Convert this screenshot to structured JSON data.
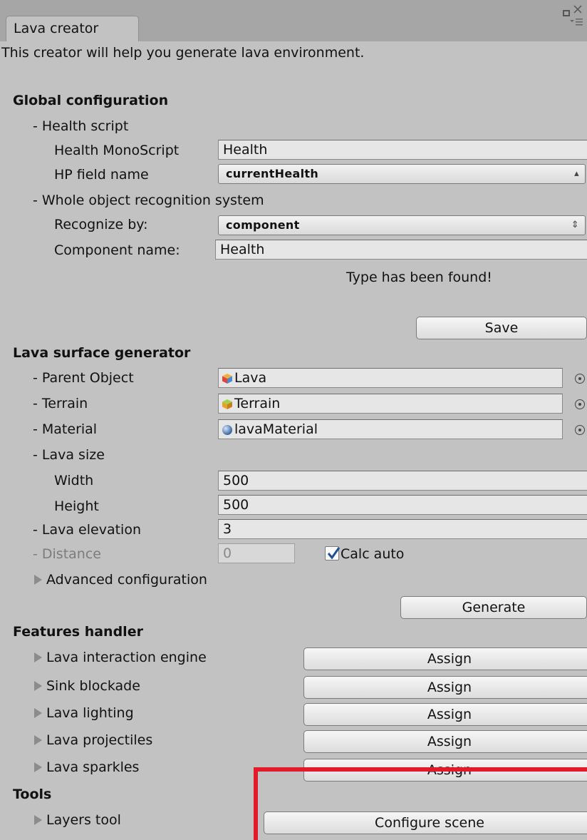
{
  "window": {
    "tab_title": "Lava creator",
    "controls": {
      "maximize_icon": "square-icon",
      "close_icon": "close-icon",
      "menu_icon": "tab-menu-icon"
    }
  },
  "intro": "This creator will help you generate lava environment.",
  "global_config": {
    "heading": "Global configuration",
    "health_script_label": "- Health script",
    "health_monoscript_label": "Health MonoScript",
    "health_monoscript_value": "Health",
    "hp_field_label": "HP field name",
    "hp_field_value": "currentHealth",
    "recognition_label": "- Whole object recognition system",
    "recognize_by_label": "Recognize by:",
    "recognize_by_value": "component",
    "component_name_label": "Component name:",
    "component_name_value": "Health",
    "status_text": "Type has been found!",
    "save_label": "Save"
  },
  "surface": {
    "heading": "Lava surface generator",
    "parent_label": "- Parent Object",
    "parent_value": "Lava",
    "terrain_label": "- Terrain",
    "terrain_value": "Terrain",
    "material_label": "- Material",
    "material_value": "lavaMaterial",
    "size_label": "- Lava size",
    "width_label": "Width",
    "width_value": "500",
    "height_label": "Height",
    "height_value": "500",
    "elevation_label": "- Lava elevation",
    "elevation_value": "3",
    "distance_label": "- Distance",
    "distance_value": "0",
    "calc_auto_label": "Calc auto",
    "calc_auto_checked": true,
    "advanced_label": "Advanced configuration",
    "generate_label": "Generate"
  },
  "features": {
    "heading": "Features handler",
    "items": [
      {
        "label": "Lava interaction engine",
        "button": "Assign"
      },
      {
        "label": "Sink blockade",
        "button": "Assign"
      },
      {
        "label": "Lava lighting",
        "button": "Assign"
      },
      {
        "label": "Lava projectiles",
        "button": "Assign"
      },
      {
        "label": "Lava sparkles",
        "button": "Assign"
      }
    ]
  },
  "tools": {
    "heading": "Tools",
    "layers_label": "Layers tool",
    "configure_label": "Configure scene"
  },
  "colors": {
    "highlight": "#e21b2b",
    "background": "#c2c2c2"
  }
}
